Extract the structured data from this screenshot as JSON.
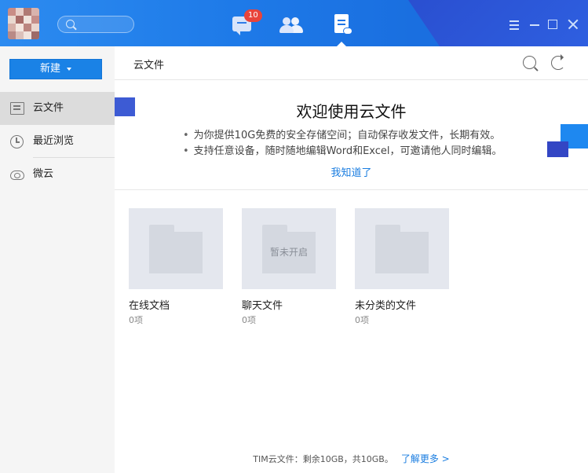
{
  "titlebar": {
    "badge_count": "10",
    "nav_icons": [
      "message-icon",
      "contacts-icon",
      "file-icon"
    ],
    "window_controls": [
      "menu-icon",
      "minimize-icon",
      "maximize-icon",
      "close-icon"
    ]
  },
  "sidebar": {
    "new_button": "新建",
    "items": [
      {
        "label": "云文件",
        "icon": "cloud-file-icon",
        "active": true
      },
      {
        "label": "最近浏览",
        "icon": "clock-icon",
        "active": false
      },
      {
        "label": "微云",
        "icon": "weiyun-cloud-icon",
        "active": false
      }
    ]
  },
  "main": {
    "breadcrumb": "云文件",
    "banner": {
      "title": "欢迎使用云文件",
      "lines": [
        "为你提供10G免费的安全存储空间；自动保存收发文件，长期有效。",
        "支持任意设备，随时随地编辑Word和Excel，可邀请他人同时编辑。"
      ],
      "dismiss": "我知道了"
    },
    "folders": [
      {
        "name": "在线文档",
        "count": "0项",
        "overlay": ""
      },
      {
        "name": "聊天文件",
        "count": "0项",
        "overlay": "暂未开启"
      },
      {
        "name": "未分类的文件",
        "count": "0项",
        "overlay": ""
      }
    ],
    "footer": {
      "text": "TIM云文件：剩余10GB，共10GB。",
      "link": "了解更多 >"
    }
  },
  "colors": {
    "titlebar": "#1e7ae8",
    "accent": "#1a82e6",
    "link": "#1a7de0",
    "badge": "#e8443a"
  }
}
